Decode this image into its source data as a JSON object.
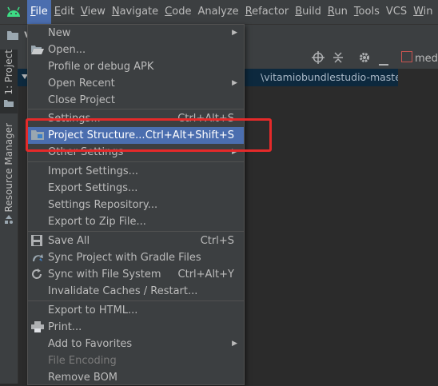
{
  "menubar": {
    "items": [
      {
        "label": "File",
        "mnemonic": "F",
        "rest": "ile",
        "active": true
      },
      {
        "label": "Edit",
        "mnemonic": "E",
        "rest": "dit"
      },
      {
        "label": "View",
        "mnemonic": "V",
        "rest": "iew"
      },
      {
        "label": "Navigate",
        "mnemonic": "N",
        "rest": "avigate"
      },
      {
        "label": "Code",
        "mnemonic": "C",
        "rest": "ode"
      },
      {
        "label": "Analyze",
        "mnemonic": "",
        "rest": "Analyze"
      },
      {
        "label": "Refactor",
        "mnemonic": "R",
        "rest": "efactor"
      },
      {
        "label": "Build",
        "mnemonic": "B",
        "rest": "uild"
      },
      {
        "label": "Run",
        "mnemonic": "R",
        "rest": "un"
      },
      {
        "label": "Tools",
        "mnemonic": "T",
        "rest": "ools"
      },
      {
        "label": "VCS",
        "mnemonic": "",
        "rest": "VCS"
      },
      {
        "label": "Win",
        "mnemonic": "W",
        "rest": "in"
      }
    ]
  },
  "nav": {
    "project_initial": "v"
  },
  "stripe": {
    "project_tab": "1: Project",
    "resource_tab": "Resource Manager"
  },
  "tree": {
    "path": "\\vitamiobundlestudio-master\\vita"
  },
  "editor": {
    "tab_label": "med"
  },
  "file_menu": {
    "items": [
      {
        "label": "New",
        "submenu": true
      },
      {
        "label": "Open...",
        "icon": "folder-open-icon"
      },
      {
        "label": "Profile or debug APK"
      },
      {
        "label": "Open Recent",
        "submenu": true
      },
      {
        "label": "Close Project"
      },
      {
        "label": "Settings...",
        "shortcut": "Ctrl+Alt+S"
      },
      {
        "label": "Project Structure...",
        "shortcut": "Ctrl+Alt+Shift+S",
        "icon": "project-structure-icon",
        "selected": true
      },
      {
        "label": "Other Settings",
        "submenu": true
      },
      {
        "label": "Import Settings..."
      },
      {
        "label": "Export Settings..."
      },
      {
        "label": "Settings Repository..."
      },
      {
        "label": "Export to Zip File..."
      },
      {
        "label": "Save All",
        "shortcut": "Ctrl+S",
        "icon": "save-icon"
      },
      {
        "label": "Sync Project with Gradle Files",
        "icon": "gradle-sync-icon"
      },
      {
        "label": "Sync with File System",
        "shortcut": "Ctrl+Alt+Y",
        "icon": "refresh-icon"
      },
      {
        "label": "Invalidate Caches / Restart..."
      },
      {
        "label": "Export to HTML..."
      },
      {
        "label": "Print...",
        "icon": "print-icon"
      },
      {
        "label": "Add to Favorites",
        "submenu": true
      },
      {
        "label": "File Encoding",
        "disabled": true
      },
      {
        "label": "Remove BOM"
      }
    ]
  },
  "colors": {
    "selection": "#4b6eaf",
    "highlight_box": "#e52a2a",
    "android_green": "#3ddc84"
  }
}
